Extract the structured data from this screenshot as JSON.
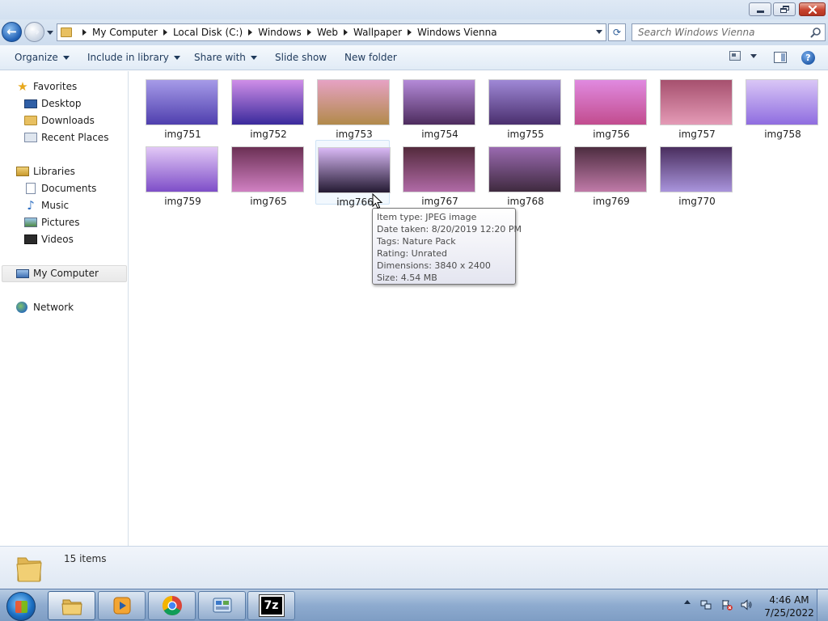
{
  "window": {
    "minimize_icon": "minimize-icon",
    "maximize_icon": "restore-icon",
    "close_icon": "close-icon"
  },
  "address": {
    "breadcrumbs": [
      "My Computer",
      "Local Disk (C:)",
      "Windows",
      "Web",
      "Wallpaper",
      "Windows Vienna"
    ]
  },
  "search": {
    "placeholder": "Search Windows Vienna"
  },
  "toolbar": {
    "organize": "Organize",
    "include_in_library": "Include in library",
    "share_with": "Share with",
    "slide_show": "Slide show",
    "new_folder": "New folder"
  },
  "nav": {
    "favorites": "Favorites",
    "desktop": "Desktop",
    "downloads": "Downloads",
    "recent_places": "Recent Places",
    "libraries": "Libraries",
    "documents": "Documents",
    "music": "Music",
    "pictures": "Pictures",
    "videos": "Videos",
    "my_computer": "My Computer",
    "network": "Network"
  },
  "files": [
    {
      "name": "img751",
      "colors": [
        "#a69be8",
        "#4f3fae"
      ]
    },
    {
      "name": "img752",
      "colors": [
        "#cf8ee8",
        "#3a2a9c"
      ]
    },
    {
      "name": "img753",
      "colors": [
        "#e6a2c4",
        "#b28a4a"
      ]
    },
    {
      "name": "img754",
      "colors": [
        "#b48ad8",
        "#4d2c5e"
      ]
    },
    {
      "name": "img755",
      "colors": [
        "#9f88d6",
        "#4a2f6e"
      ]
    },
    {
      "name": "img756",
      "colors": [
        "#e08ae0",
        "#c24c8e"
      ]
    },
    {
      "name": "img757",
      "colors": [
        "#a6506e",
        "#e49ab6"
      ]
    },
    {
      "name": "img758",
      "colors": [
        "#d9c6f6",
        "#8f6de0"
      ]
    },
    {
      "name": "img759",
      "colors": [
        "#e2c8f6",
        "#7e4ec8"
      ]
    },
    {
      "name": "img765",
      "colors": [
        "#6b3054",
        "#d080c2"
      ]
    },
    {
      "name": "img766",
      "colors": [
        "#d8b8f4",
        "#241a32"
      ]
    },
    {
      "name": "img767",
      "colors": [
        "#532a3c",
        "#b06aa6"
      ]
    },
    {
      "name": "img768",
      "colors": [
        "#9a6ab0",
        "#3f2a3f"
      ]
    },
    {
      "name": "img769",
      "colors": [
        "#4d2d40",
        "#c07aa8"
      ]
    },
    {
      "name": "img770",
      "colors": [
        "#4a2e5e",
        "#a994dc"
      ]
    }
  ],
  "tooltip": {
    "type": "Item type: JPEG image",
    "date": "Date taken: 8/20/2019 12:20 PM",
    "tags": "Tags: Nature Pack",
    "rating": "Rating: Unrated",
    "dimensions": "Dimensions: 3840 x 2400",
    "size": "Size: 4.54 MB"
  },
  "status": {
    "items": "15 items"
  },
  "taskbar": {
    "apps": [
      "explorer-icon",
      "media-player-icon",
      "chrome-icon",
      "control-panel-icon",
      "7zip-icon"
    ],
    "seven_zip_label": "7z",
    "time": "4:46 AM",
    "date": "7/25/2022"
  }
}
